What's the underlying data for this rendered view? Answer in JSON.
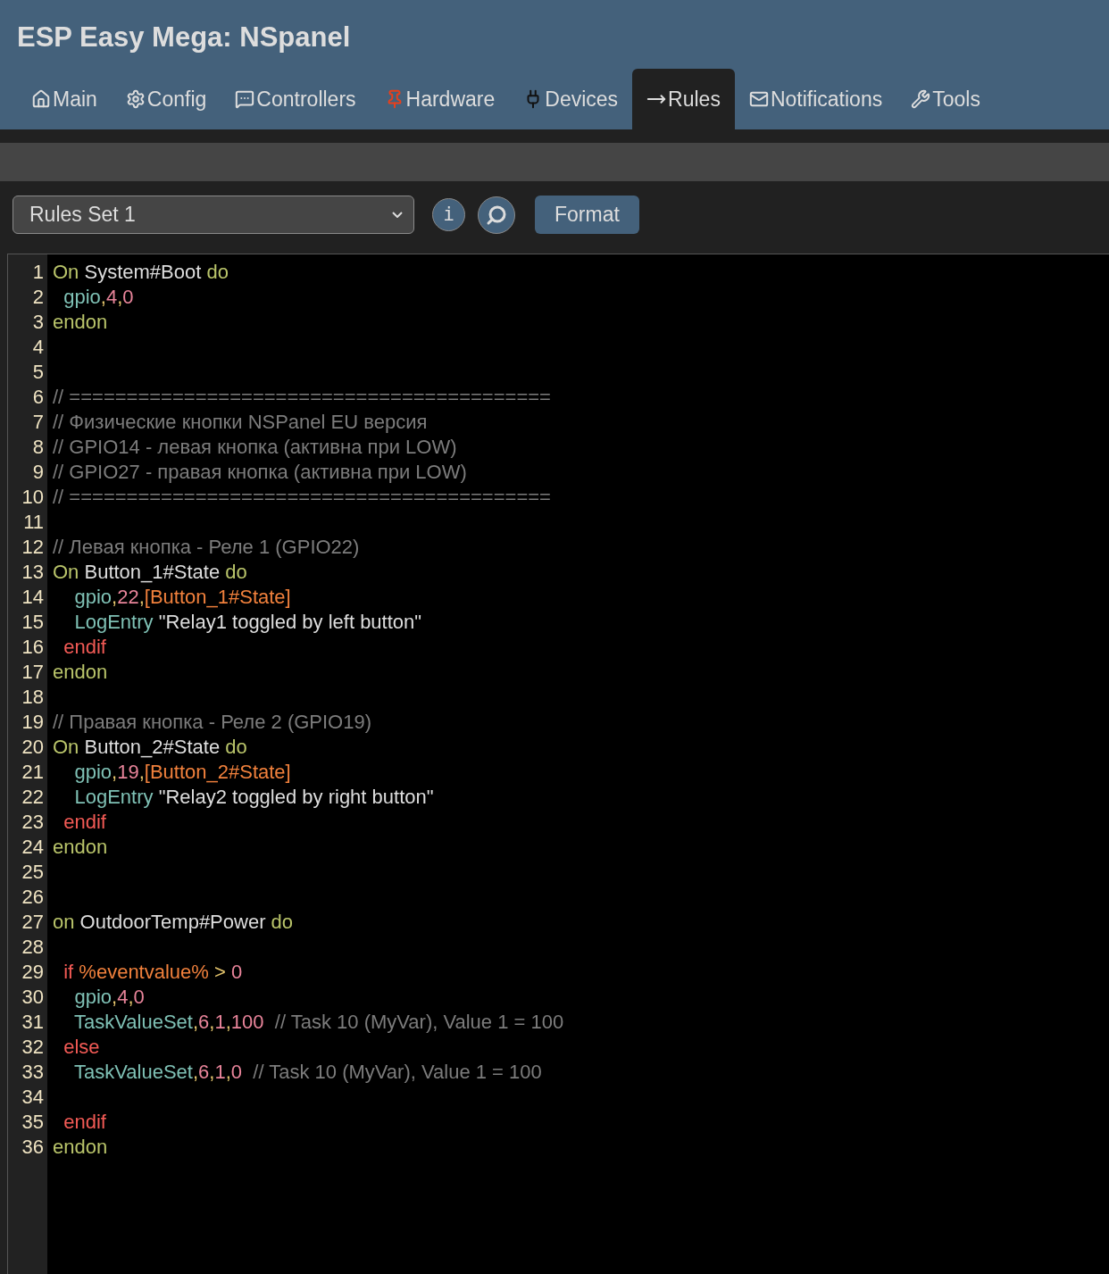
{
  "title": "ESP Easy Mega: NSpanel",
  "tabs": [
    {
      "label": "Main",
      "kind": "home",
      "selected": false
    },
    {
      "label": "Config",
      "kind": "gear",
      "selected": false
    },
    {
      "label": "Controllers",
      "kind": "chat",
      "selected": false
    },
    {
      "label": "Hardware",
      "kind": "pin",
      "selected": false
    },
    {
      "label": "Devices",
      "kind": "plug",
      "selected": false
    },
    {
      "label": "Rules",
      "kind": "arrow",
      "selected": true
    },
    {
      "label": "Notifications",
      "kind": "mail",
      "selected": false
    },
    {
      "label": "Tools",
      "kind": "wrench",
      "selected": false
    }
  ],
  "toolbar": {
    "rules_set": "Rules Set 1",
    "info_label": "i",
    "format_label": "Format"
  },
  "code_lines": [
    {
      "number": "1",
      "tokens": [
        {
          "kind": "kw",
          "text": "On "
        },
        {
          "kind": "plain",
          "text": "System#Boot "
        },
        {
          "kind": "kw",
          "text": "do"
        }
      ]
    },
    {
      "number": "2",
      "tokens": [
        {
          "kind": "cmd",
          "text": "  gpio"
        },
        {
          "kind": "punct",
          "text": ","
        },
        {
          "kind": "num",
          "text": "4"
        },
        {
          "kind": "punct",
          "text": ","
        },
        {
          "kind": "num",
          "text": "0"
        }
      ]
    },
    {
      "number": "3",
      "tokens": [
        {
          "kind": "kw",
          "text": "endon"
        }
      ]
    },
    {
      "number": "4"
    },
    {
      "number": "5"
    },
    {
      "number": "6",
      "tokens": [
        {
          "kind": "comment",
          "text": "// =========================================="
        }
      ]
    },
    {
      "number": "7",
      "tokens": [
        {
          "kind": "comment",
          "text": "// Физические кнопки NSPanel EU версия"
        }
      ]
    },
    {
      "number": "8",
      "tokens": [
        {
          "kind": "comment",
          "text": "// GPIO14 - левая кнопка (активна при LOW)"
        }
      ]
    },
    {
      "number": "9",
      "tokens": [
        {
          "kind": "comment",
          "text": "// GPIO27 - правая кнопка (активна при LOW)"
        }
      ]
    },
    {
      "number": "10",
      "tokens": [
        {
          "kind": "comment",
          "text": "// =========================================="
        }
      ]
    },
    {
      "number": "11"
    },
    {
      "number": "12",
      "tokens": [
        {
          "kind": "comment",
          "text": "// Левая кнопка - Реле 1 (GPIO22)"
        }
      ]
    },
    {
      "number": "13",
      "tokens": [
        {
          "kind": "kw",
          "text": "On "
        },
        {
          "kind": "plain",
          "text": "Button_1#State "
        },
        {
          "kind": "kw",
          "text": "do"
        }
      ]
    },
    {
      "number": "14",
      "tokens": [
        {
          "kind": "cmd",
          "text": "    gpio"
        },
        {
          "kind": "punct",
          "text": ","
        },
        {
          "kind": "num",
          "text": "22"
        },
        {
          "kind": "punct",
          "text": ","
        },
        {
          "kind": "var",
          "text": "[Button_1#State]"
        }
      ]
    },
    {
      "number": "15",
      "tokens": [
        {
          "kind": "cmd",
          "text": "    LogEntry "
        },
        {
          "kind": "plain",
          "text": "\"Relay1 toggled by left button\""
        }
      ]
    },
    {
      "number": "16",
      "tokens": [
        {
          "kind": "ctl",
          "text": "  endif"
        }
      ]
    },
    {
      "number": "17",
      "tokens": [
        {
          "kind": "kw",
          "text": "endon"
        }
      ]
    },
    {
      "number": "18"
    },
    {
      "number": "19",
      "tokens": [
        {
          "kind": "comment",
          "text": "// Правая кнопка - Реле 2 (GPIO19)"
        }
      ]
    },
    {
      "number": "20",
      "tokens": [
        {
          "kind": "kw",
          "text": "On "
        },
        {
          "kind": "plain",
          "text": "Button_2#State "
        },
        {
          "kind": "kw",
          "text": "do"
        }
      ]
    },
    {
      "number": "21",
      "tokens": [
        {
          "kind": "cmd",
          "text": "    gpio"
        },
        {
          "kind": "punct",
          "text": ","
        },
        {
          "kind": "num",
          "text": "19"
        },
        {
          "kind": "punct",
          "text": ","
        },
        {
          "kind": "var",
          "text": "[Button_2#State]"
        }
      ]
    },
    {
      "number": "22",
      "tokens": [
        {
          "kind": "cmd",
          "text": "    LogEntry "
        },
        {
          "kind": "plain",
          "text": "\"Relay2 toggled by right button\""
        }
      ]
    },
    {
      "number": "23",
      "tokens": [
        {
          "kind": "ctl",
          "text": "  endif"
        }
      ]
    },
    {
      "number": "24",
      "tokens": [
        {
          "kind": "kw",
          "text": "endon"
        }
      ]
    },
    {
      "number": "25"
    },
    {
      "number": "26"
    },
    {
      "number": "27",
      "tokens": [
        {
          "kind": "kw",
          "text": "on "
        },
        {
          "kind": "plain",
          "text": "OutdoorTemp#Power "
        },
        {
          "kind": "kw",
          "text": "do"
        }
      ]
    },
    {
      "number": "28"
    },
    {
      "number": "29",
      "tokens": [
        {
          "kind": "ctl",
          "text": "  if "
        },
        {
          "kind": "var",
          "text": "%eventvalue% "
        },
        {
          "kind": "punct",
          "text": "> "
        },
        {
          "kind": "num",
          "text": "0"
        }
      ]
    },
    {
      "number": "30",
      "tokens": [
        {
          "kind": "cmd",
          "text": "    gpio"
        },
        {
          "kind": "punct",
          "text": ","
        },
        {
          "kind": "num",
          "text": "4"
        },
        {
          "kind": "punct",
          "text": ","
        },
        {
          "kind": "num",
          "text": "0"
        }
      ]
    },
    {
      "number": "31",
      "tokens": [
        {
          "kind": "cmd",
          "text": "    TaskValueSet"
        },
        {
          "kind": "punct",
          "text": ","
        },
        {
          "kind": "num",
          "text": "6"
        },
        {
          "kind": "punct",
          "text": ","
        },
        {
          "kind": "num",
          "text": "1"
        },
        {
          "kind": "punct",
          "text": ","
        },
        {
          "kind": "num",
          "text": "100"
        },
        {
          "kind": "comment",
          "text": "  // Task 10 (MyVar), Value 1 = 100"
        }
      ]
    },
    {
      "number": "32",
      "tokens": [
        {
          "kind": "ctl",
          "text": "  else"
        }
      ]
    },
    {
      "number": "33",
      "tokens": [
        {
          "kind": "cmd",
          "text": "    TaskValueSet"
        },
        {
          "kind": "punct",
          "text": ","
        },
        {
          "kind": "num",
          "text": "6"
        },
        {
          "kind": "punct",
          "text": ","
        },
        {
          "kind": "num",
          "text": "1"
        },
        {
          "kind": "punct",
          "text": ","
        },
        {
          "kind": "num",
          "text": "0"
        },
        {
          "kind": "comment",
          "text": "  // Task 10 (MyVar), Value 1 = 100"
        }
      ]
    },
    {
      "number": "34"
    },
    {
      "number": "35",
      "tokens": [
        {
          "kind": "ctl",
          "text": "  endif"
        }
      ]
    },
    {
      "number": "36",
      "tokens": [
        {
          "kind": "kw",
          "text": "endon"
        }
      ]
    }
  ]
}
